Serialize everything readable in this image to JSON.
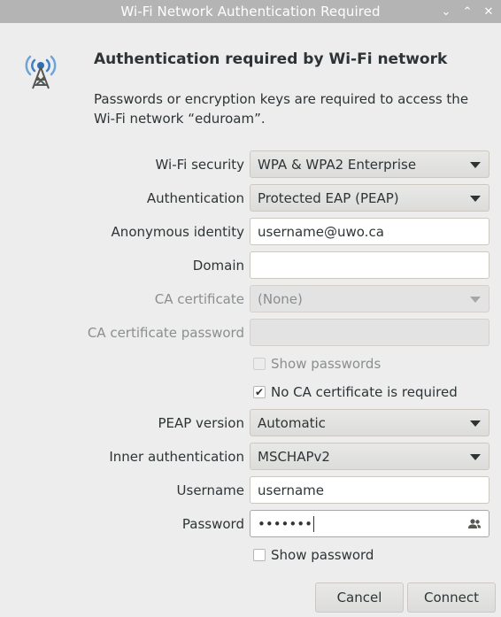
{
  "window": {
    "title": "Wi-Fi Network Authentication Required",
    "controls": {
      "minimize": "⌄",
      "maximize": "⌃",
      "close": "✕"
    }
  },
  "dialog": {
    "heading": "Authentication required by Wi-Fi network",
    "message": "Passwords or encryption keys are required to access the Wi-Fi network “eduroam”."
  },
  "form": {
    "wifi_security": {
      "label": "Wi-Fi security",
      "value": "WPA & WPA2 Enterprise"
    },
    "authentication": {
      "label": "Authentication",
      "value": "Protected EAP (PEAP)"
    },
    "anonymous_identity": {
      "label": "Anonymous identity",
      "value": "username@uwo.ca"
    },
    "domain": {
      "label": "Domain",
      "value": ""
    },
    "ca_certificate": {
      "label": "CA certificate",
      "value": "(None)"
    },
    "ca_certificate_password": {
      "label": "CA certificate password",
      "value": ""
    },
    "show_passwords": {
      "label": "Show passwords",
      "checked": false
    },
    "no_ca_required": {
      "label": "No CA certificate is required",
      "checked": true
    },
    "peap_version": {
      "label": "PEAP version",
      "value": "Automatic"
    },
    "inner_authentication": {
      "label": "Inner authentication",
      "value": "MSCHAPv2"
    },
    "username": {
      "label": "Username",
      "value": "username"
    },
    "password": {
      "label": "Password",
      "value": "•••••••"
    },
    "show_password": {
      "label": "Show password",
      "checked": false
    }
  },
  "buttons": {
    "cancel": "Cancel",
    "connect": "Connect"
  },
  "colors": {
    "titlebar": "#b4b4b4",
    "background": "#ededed"
  }
}
